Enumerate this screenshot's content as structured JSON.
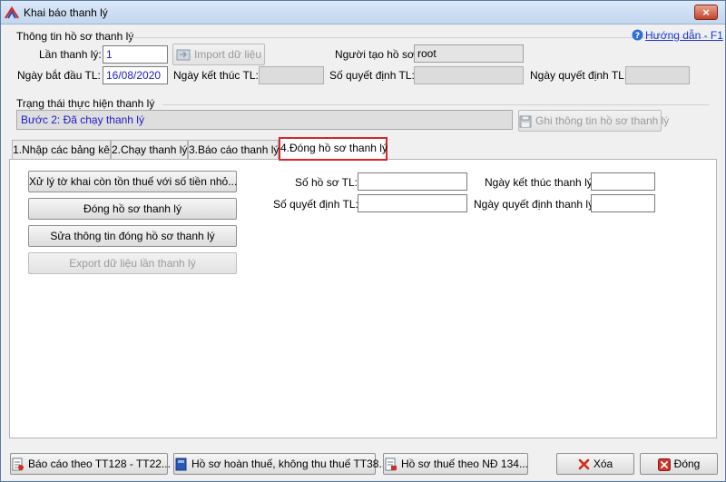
{
  "window": {
    "title": "Khai báo thanh lý",
    "close": "×"
  },
  "help": {
    "label": "Hướng dẫn - F1"
  },
  "group_info": {
    "title": "Thông tin hồ sơ thanh lý",
    "lan_thanh_ly_label": "Lần thanh lý:",
    "lan_thanh_ly_value": "1",
    "import_label": "Import dữ liệu",
    "nguoi_tao_label": "Người tạo hồ sơ:",
    "nguoi_tao_value": "root",
    "ngay_bat_dau_label": "Ngày bắt đầu TL:",
    "ngay_bat_dau_value": "16/08/2020",
    "ngay_ket_thuc_label": "Ngày kết thúc TL:",
    "so_quyet_dinh_label": "Số quyết định TL:",
    "ngay_quyet_dinh_label": "Ngày quyết định TL:"
  },
  "group_status": {
    "title": "Trạng thái thực hiện thanh lý",
    "value": "Bước 2: Đã chạy thanh lý",
    "save_label": "Ghi thông tin hồ sơ thanh lý"
  },
  "tabs": [
    {
      "label": "1.Nhập các bảng kê"
    },
    {
      "label": "2.Chạy thanh lý"
    },
    {
      "label": "3.Báo cáo thanh lý"
    },
    {
      "label": "4.Đóng hồ sơ thanh lý"
    }
  ],
  "panel": {
    "buttons": [
      {
        "label": "Xử lý tờ khai còn tồn thuế với số tiền nhỏ..."
      },
      {
        "label": "Đóng hồ sơ thanh lý"
      },
      {
        "label": "Sửa thông tin đóng hồ sơ thanh lý"
      },
      {
        "label": "Export dữ liệu lần thanh lý"
      }
    ],
    "so_ho_so_label": "Số hồ sơ TL:",
    "so_quyet_dinh_label": "Số quyết định TL:",
    "ngay_ket_thuc_label": "Ngày kết thúc thanh lý:",
    "ngay_quyet_dinh_label": "Ngày quyết định thanh lý:"
  },
  "footer": {
    "report_tt128": "Báo cáo theo TT128 - TT22...",
    "ho_so_hoan_thue": "Hồ sơ hoàn thuế, không thu thuế TT38...",
    "ho_so_nd134": "Hồ sơ thuế theo NĐ 134...",
    "delete": "Xóa",
    "close": "Đóng"
  }
}
